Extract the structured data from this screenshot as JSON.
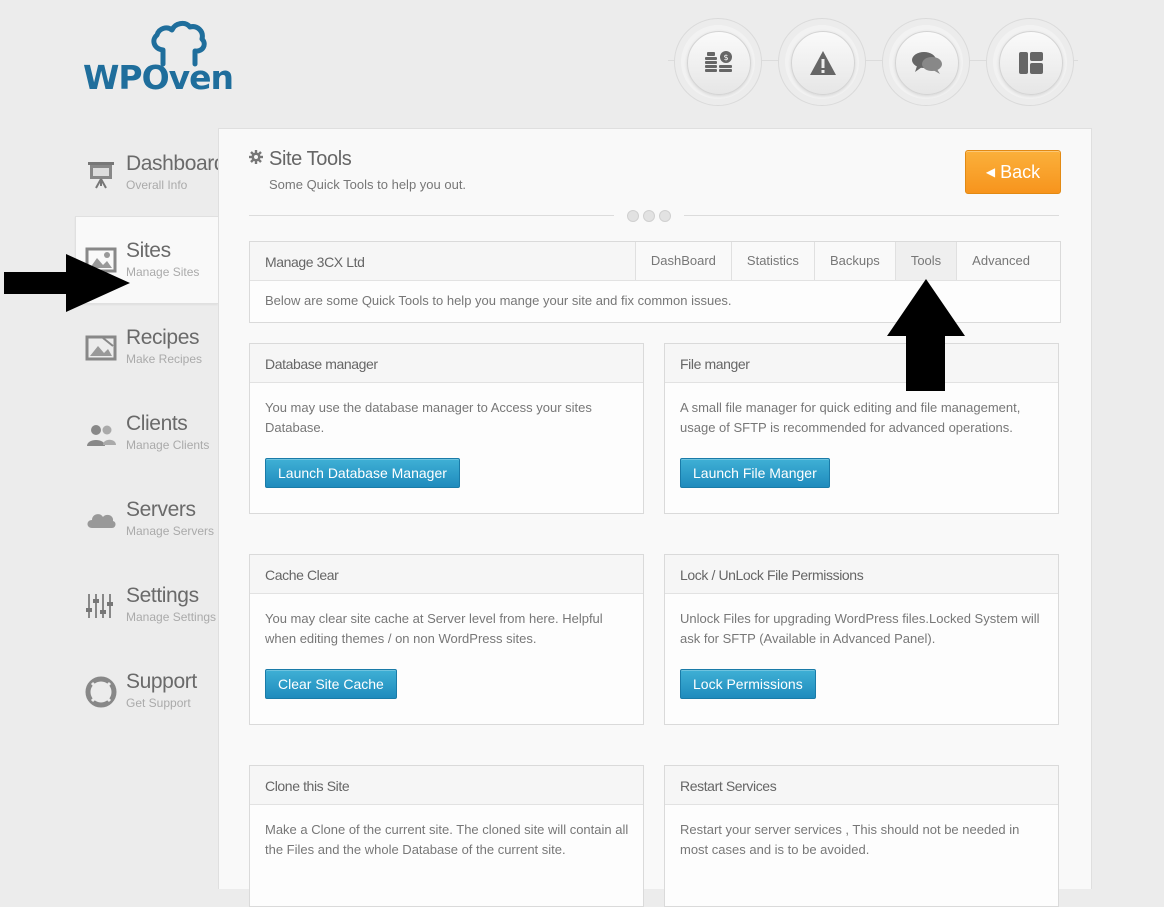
{
  "brand": {
    "name": "WPOven",
    "color": "#1f6e9c"
  },
  "top_icons": [
    "coins-icon",
    "warning-icon",
    "chat-icon",
    "layout-icon"
  ],
  "sidebar": {
    "items": [
      {
        "title": "Dashboard",
        "subtitle": "Overall Info",
        "icon": "presentation-icon"
      },
      {
        "title": "Sites",
        "subtitle": "Manage Sites",
        "icon": "image-icon",
        "active": true
      },
      {
        "title": "Recipes",
        "subtitle": "Make Recipes",
        "icon": "photo-recipe-icon"
      },
      {
        "title": "Clients",
        "subtitle": "Manage Clients",
        "icon": "users-icon"
      },
      {
        "title": "Servers",
        "subtitle": "Manage Servers",
        "icon": "cloud-icon"
      },
      {
        "title": "Settings",
        "subtitle": "Manage Settings",
        "icon": "sliders-icon"
      },
      {
        "title": "Support",
        "subtitle": "Get Support",
        "icon": "lifebuoy-icon"
      }
    ]
  },
  "header": {
    "title": "Site Tools",
    "subtitle": "Some Quick Tools to help you out.",
    "back_label": "Back"
  },
  "manage": {
    "title": "Manage 3CX Ltd",
    "tabs": [
      "DashBoard",
      "Statistics",
      "Backups",
      "Tools",
      "Advanced"
    ],
    "active_tab": "Tools",
    "description": "Below are some Quick Tools to help you mange your site and fix common issues."
  },
  "cards": [
    {
      "title": "Database manager",
      "description": "You may use the database manager to Access your sites Database.",
      "button": "Launch Database Manager"
    },
    {
      "title": "File manger",
      "description": "A small file manager for quick editing and file management, usage of SFTP is recommended for advanced operations.",
      "button": "Launch File Manger"
    },
    {
      "title": "Cache Clear",
      "description": "You may clear site cache at Server level from here. Helpful when editing themes / on non WordPress sites.",
      "button": "Clear Site Cache"
    },
    {
      "title": "Lock / UnLock File Permissions",
      "description": "Unlock Files for upgrading WordPress files.Locked System will ask for SFTP (Available in Advanced Panel).",
      "button": "Lock Permissions"
    },
    {
      "title": "Clone this Site",
      "description": "Make a Clone of the current site. The cloned site will contain all the Files and the whole Database of the current site.",
      "button": ""
    },
    {
      "title": "Restart Services",
      "description": "Restart your server services , This should not be needed in most cases and is to be avoided.",
      "button": ""
    }
  ],
  "colors": {
    "accent_orange": "#f7941d",
    "button_blue": "#2a9bc9"
  }
}
